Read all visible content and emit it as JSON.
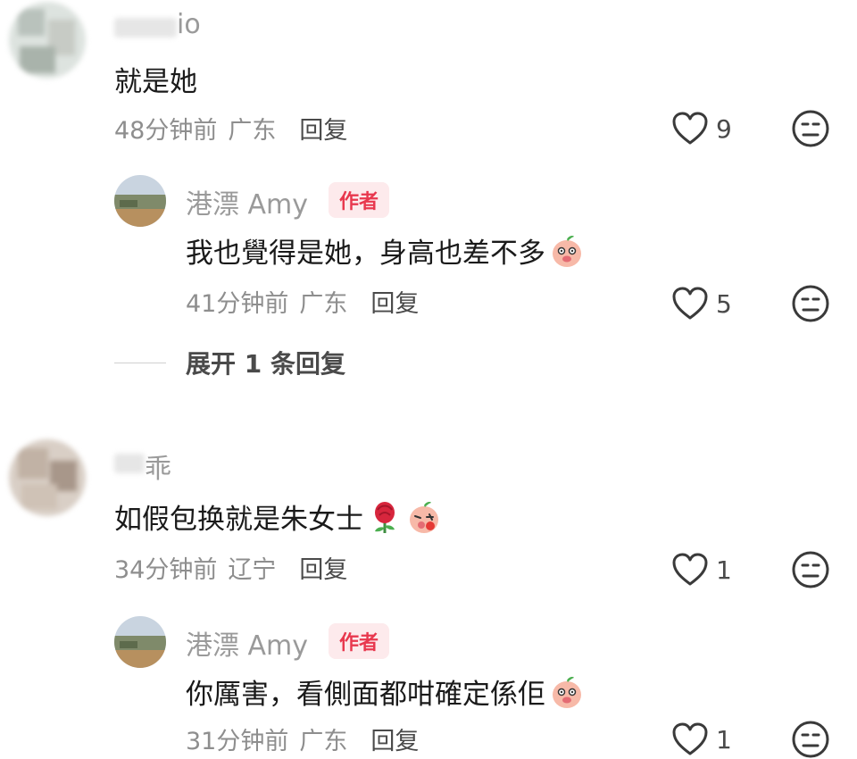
{
  "comments": [
    {
      "username_fragment": "io",
      "text": "就是她",
      "time": "48分钟前",
      "location": "广东",
      "reply_label": "回复",
      "likes": "9",
      "replies": [
        {
          "username": "港漂 Amy",
          "author_tag": "作者",
          "text": "我也覺得是她，身高也差不多",
          "time": "41分钟前",
          "location": "广东",
          "reply_label": "回复",
          "likes": "5"
        }
      ],
      "expand_label": "展开 1 条回复"
    },
    {
      "username_fragment": "乖",
      "text": "如假包换就是朱女士",
      "time": "34分钟前",
      "location": "辽宁",
      "reply_label": "回复",
      "likes": "1",
      "replies": [
        {
          "username": "港漂 Amy",
          "author_tag": "作者",
          "text": "你厲害，看側面都咁確定係佢",
          "time": "31分钟前",
          "location": "广东",
          "reply_label": "回复",
          "likes": "1"
        }
      ]
    }
  ],
  "icons": {
    "like": "heart-outline-icon",
    "dislike": "neutral-face-icon",
    "emoji_peach": "peach-emoji-icon",
    "emoji_rose": "rose-emoji-icon"
  },
  "colors": {
    "author_tag_bg": "#fdeaec",
    "author_tag_text": "#e8384e",
    "meta_text": "#8e8e8e"
  }
}
